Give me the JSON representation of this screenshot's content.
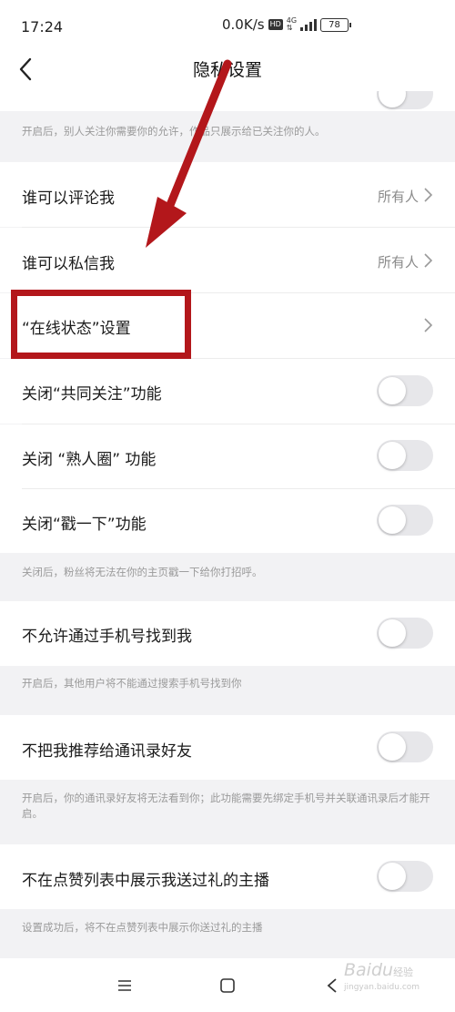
{
  "status_bar": {
    "time": "17:24",
    "net_speed": "0.0K/s",
    "hd": "HD",
    "net_type": "4G",
    "battery": "78"
  },
  "nav": {
    "title": "隐私设置"
  },
  "top_note": "开启后，别人关注你需要你的允许，作品只展示给已关注你的人。",
  "comment": {
    "label": "谁可以评论我",
    "value": "所有人"
  },
  "message": {
    "label": "谁可以私信我",
    "value": "所有人"
  },
  "online_status": {
    "label": "“在线状态”设置"
  },
  "mutual_follow": {
    "label": "关闭“共同关注”功能",
    "on": false
  },
  "acquaintance": {
    "label": "关闭 “熟人圈” 功能",
    "on": false
  },
  "poke": {
    "label": "关闭“戳一下”功能",
    "on": false
  },
  "poke_note": "关闭后，粉丝将无法在你的主页戳一下给你打招呼。",
  "phone_search": {
    "label": "不允许通过手机号找到我",
    "on": false
  },
  "phone_note": "开启后，其他用户将不能通过搜索手机号找到你",
  "contacts": {
    "label": "不把我推荐给通讯录好友",
    "on": false
  },
  "contacts_note": "开启后，你的通讯录好友将无法看到你；此功能需要先绑定手机号并关联通讯录后才能开启。",
  "gift": {
    "label": "不在点赞列表中展示我送过礼的主播",
    "on": false
  },
  "gift_note": "设置成功后，将不在点赞列表中展示你送过礼的主播",
  "annotation_color": "#b3171b",
  "watermark": {
    "brand": "Baidu",
    "sub": "经验",
    "url": "jingyan.baidu.com"
  }
}
